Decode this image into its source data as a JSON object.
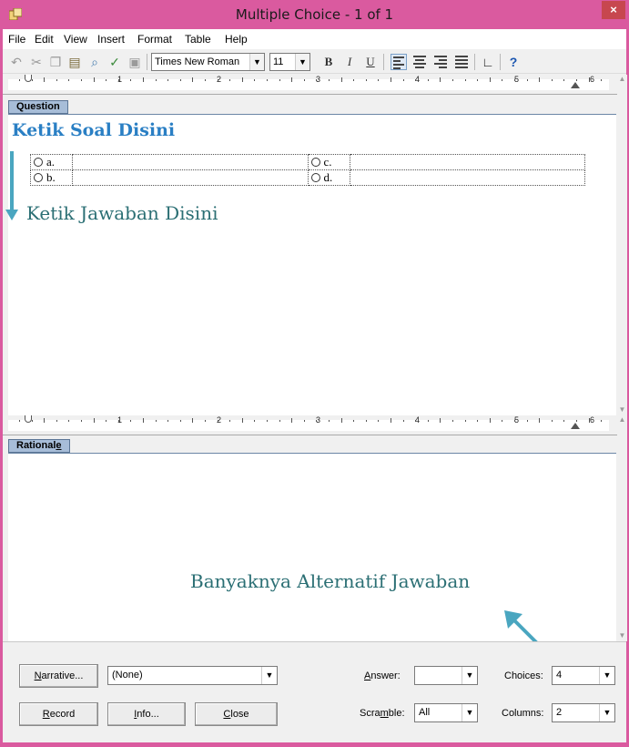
{
  "window": {
    "title": "Multiple Choice - 1 of 1",
    "close_glyph": "×"
  },
  "menu": [
    "File",
    "Edit",
    "View",
    "Insert",
    "Format",
    "Table",
    "Help"
  ],
  "toolbar": {
    "font_name": "Times New Roman",
    "font_size": "11",
    "bold": "B",
    "italic": "I",
    "underline": "U",
    "icons": [
      "undo-icon",
      "cut-icon",
      "copy-icon",
      "paste-icon",
      "find-icon",
      "spellcheck-icon",
      "image-icon",
      "align-left-icon",
      "align-center-icon",
      "align-right-icon",
      "justify-icon",
      "tab-stop-icon",
      "help-icon"
    ]
  },
  "ruler": {
    "numbers": [
      "1",
      "2",
      "3",
      "4",
      "5",
      "6"
    ]
  },
  "question": {
    "label": "Question",
    "hint": "Ketik Soal Disini",
    "options": [
      {
        "letter": "a.",
        "text": ""
      },
      {
        "letter": "b.",
        "text": ""
      },
      {
        "letter": "c.",
        "text": ""
      },
      {
        "letter": "d.",
        "text": ""
      }
    ],
    "answer_hint": "Ketik Jawaban Disini"
  },
  "rationale": {
    "label_pre": "Rational",
    "label_u": "e",
    "hint": "Banyaknya Alternatif Jawaban"
  },
  "bottom": {
    "narrative_u": "N",
    "narrative_rest": "arrative...",
    "narrative_value": "(None)",
    "answer_pre": "",
    "answer_u": "A",
    "answer_rest": "nswer:",
    "answer_value": "",
    "choices_label": "Choices:",
    "choices_value": "4",
    "scramble_pre": "Scra",
    "scramble_u": "m",
    "scramble_rest": "ble:",
    "scramble_value": "All",
    "columns_label": "Columns:",
    "columns_value": "2",
    "record_u": "R",
    "record_rest": "ecord",
    "info_u": "I",
    "info_rest": "nfo...",
    "close_u": "C",
    "close_rest": "lose"
  },
  "colors": {
    "titlebar": "#da5a9f",
    "hint_text": "#2b6f74",
    "arrow": "#4aa6c0",
    "pane_label": "#a7bdd8"
  }
}
